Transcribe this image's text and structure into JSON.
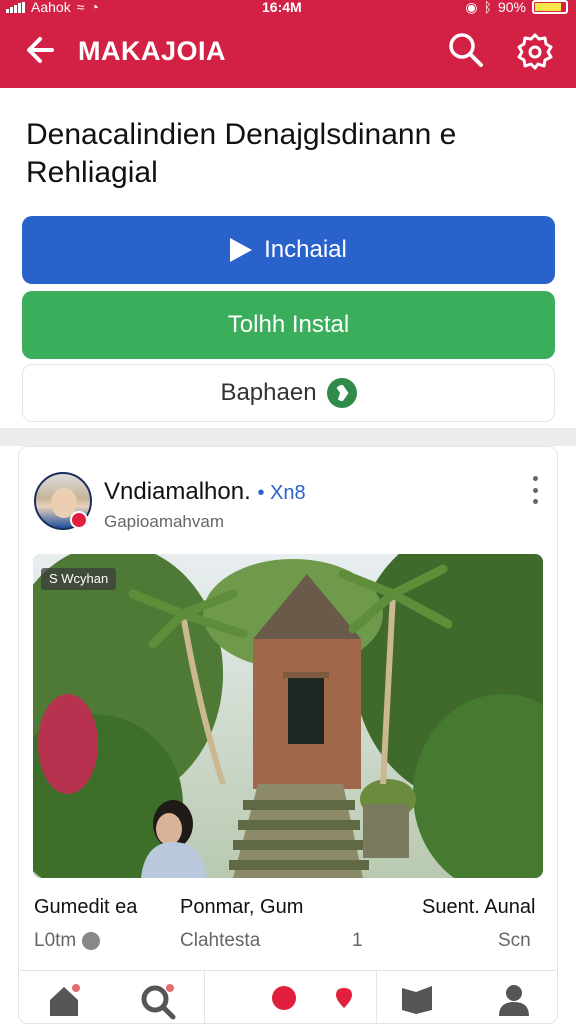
{
  "status_bar": {
    "carrier": "Aahok",
    "time": "16:4M",
    "battery": "90%"
  },
  "app_bar": {
    "title": "MAKAJOIA",
    "background_color": "#d32045"
  },
  "headline": "Denacalindien Denajglsdinann e Rehliagial",
  "actions": {
    "primary_label": "Inchaial",
    "primary_color": "#2a62cc",
    "secondary_label": "Tolhh Instal",
    "secondary_color": "#3aae5a",
    "tertiary_label": "Baphaen"
  },
  "post": {
    "author": "Vndiamalhon.",
    "author_tag": "• Xn8",
    "subtitle": "Gapioamahvam",
    "photo_badge": "S Wcyhan",
    "stats": [
      {
        "label": "Gumedit ea",
        "value": "L0tm"
      },
      {
        "label": "Ponmar, Gum",
        "value": "Clahtesta"
      },
      {
        "label": "Suent. Aunal",
        "value": "Scn"
      }
    ],
    "stat_count": "1"
  },
  "bottom_nav": [
    "home-icon",
    "search-icon",
    "record-icon",
    "location-icon",
    "chat-icon",
    "profile-icon"
  ]
}
